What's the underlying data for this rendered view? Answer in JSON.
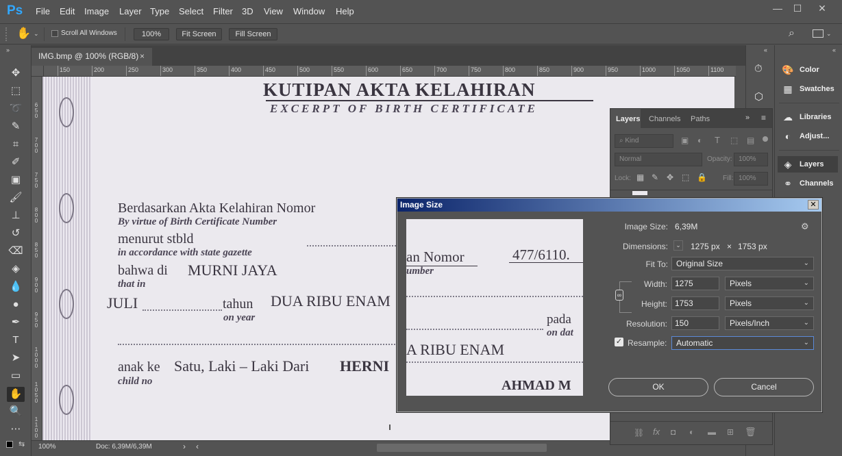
{
  "app": {
    "logo": "Ps"
  },
  "menu": [
    "File",
    "Edit",
    "Image",
    "Layer",
    "Type",
    "Select",
    "Filter",
    "3D",
    "View",
    "Window",
    "Help"
  ],
  "window_controls": {
    "minimize": "—",
    "maximize": "☐",
    "close": "✕"
  },
  "options_bar": {
    "scroll_all_windows_label": "Scroll All Windows",
    "zoom_value": "100%",
    "fit_screen": "Fit Screen",
    "fill_screen": "Fill Screen"
  },
  "document": {
    "tab_title": "IMG.bmp @ 100% (RGB/8)",
    "tab_close": "×",
    "zoom": "100%",
    "doc_size": "Doc: 6,39M/6,39M"
  },
  "ruler_h_ticks": [
    "150",
    "200",
    "250",
    "300",
    "350",
    "400",
    "450",
    "500",
    "550",
    "600",
    "650",
    "700",
    "750",
    "800",
    "850",
    "900",
    "950",
    "1000",
    "1050",
    "1100"
  ],
  "ruler_v_ticks": [
    "6\n5\n0",
    "7\n0\n0",
    "7\n5\n0",
    "8\n0\n0",
    "8\n5\n0",
    "9\n0\n0",
    "9\n5\n0",
    "1\n0\n0\n0",
    "1\n0\n5\n0",
    "1\n1\n0\n0"
  ],
  "certificate": {
    "title": "KUTIPAN AKTA KELAHIRAN",
    "subtitle": "EXCERPT OF BIRTH CERTIFICATE",
    "line1": "Berdasarkan Akta Kelahiran Nomor",
    "line1_en": "By virtue of Birth Certificate Number",
    "line2": "menurut stbld",
    "line2_en": "in accordance with state gazette",
    "line3": "bahwa di",
    "line3_value": "MURNI JAYA",
    "line3_en": "that in",
    "month": "JULI",
    "tahun": "tahun",
    "tahun_en": "on year",
    "year_value": "DUA RIBU ENAM",
    "anak_ke": "anak ke",
    "anak_ke_value": "Satu, Laki – Laki  Dari",
    "parent": "HERNI",
    "child_no": "child no"
  },
  "preview": {
    "nomor": "an Nomor",
    "number_en": "umber",
    "cert_no": "477/6110.",
    "year": "A RIBU ENAM",
    "pada": "pada",
    "on_date": "on dat",
    "name": "AHMAD  M"
  },
  "right_panel": {
    "items": [
      "Color",
      "Swatches",
      "Libraries",
      "Adjust...",
      "Layers",
      "Channels"
    ]
  },
  "layers_panel": {
    "tabs": [
      "Layers",
      "Channels",
      "Paths"
    ],
    "kind": "Kind",
    "blend_mode": "Normal",
    "opacity_label": "Opacity:",
    "opacity_value": "100%",
    "lock_label": "Lock:",
    "fill_label": "Fill:",
    "fill_value": "100%"
  },
  "dialog": {
    "title": "Image Size",
    "close": "✕",
    "image_size_label": "Image Size:",
    "image_size_value": "6,39M",
    "dimensions_label": "Dimensions:",
    "dim_w": "1275 px",
    "dim_x": "×",
    "dim_h": "1753 px",
    "fit_to_label": "Fit To:",
    "fit_to_value": "Original Size",
    "width_label": "Width:",
    "width_value": "1275",
    "width_unit": "Pixels",
    "height_label": "Height:",
    "height_value": "1753",
    "height_unit": "Pixels",
    "resolution_label": "Resolution:",
    "resolution_value": "150",
    "resolution_unit": "Pixels/Inch",
    "resample_label": "Resample:",
    "resample_value": "Automatic",
    "ok": "OK",
    "cancel": "Cancel"
  },
  "colors": {
    "accent_blue": "#31a8ff",
    "titlebar_start": "#0b246a",
    "titlebar_end": "#a6caf0",
    "ui_bg": "#535353"
  }
}
